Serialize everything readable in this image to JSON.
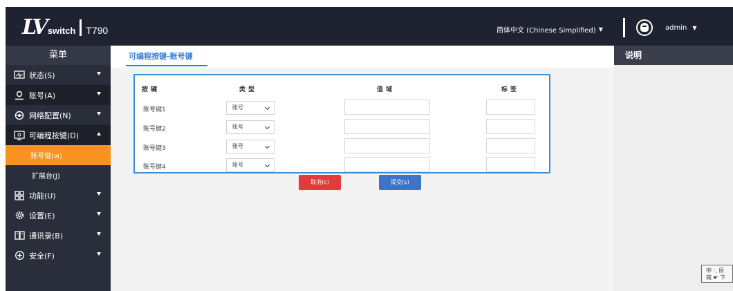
{
  "header": {
    "logo_mark": "LV",
    "logo_text": "switch",
    "model": "T790",
    "language": "简体中文 (Chinese Simplified)",
    "user": "admin"
  },
  "sidebar": {
    "title": "菜单",
    "items": [
      {
        "label": "状态(S)",
        "icon": "monitor-icon",
        "arrow": "down"
      },
      {
        "label": "账号(A)",
        "icon": "user-icon",
        "arrow": "down"
      },
      {
        "label": "网络配置(N)",
        "icon": "network-icon",
        "arrow": "down"
      },
      {
        "label": "可编程按键(D)",
        "icon": "keyboard-icon",
        "arrow": "up"
      }
    ],
    "subitems": [
      {
        "label": "账号键(w)",
        "active": true
      },
      {
        "label": "扩展台(J)",
        "active": false
      }
    ],
    "items2": [
      {
        "label": "功能(U)",
        "icon": "grid-icon",
        "arrow": "down"
      },
      {
        "label": "设置(E)",
        "icon": "gear-icon",
        "arrow": "down"
      },
      {
        "label": "通讯录(B)",
        "icon": "book-icon",
        "arrow": "down"
      },
      {
        "label": "安全(F)",
        "icon": "shield-icon",
        "arrow": "down"
      }
    ]
  },
  "main": {
    "breadcrumb": "可编程按键-账号键",
    "table": {
      "headers": [
        "按键",
        "类型",
        "值域",
        "标签"
      ],
      "rows": [
        {
          "key": "账号键1",
          "type": "账号",
          "value": "",
          "label": ""
        },
        {
          "key": "账号键2",
          "type": "账号",
          "value": "",
          "label": ""
        },
        {
          "key": "账号键3",
          "type": "账号",
          "value": "",
          "label": ""
        },
        {
          "key": "账号键4",
          "type": "账号",
          "value": "",
          "label": ""
        }
      ]
    },
    "cancel_label": "取消(c)",
    "submit_label": "提交(s)"
  },
  "help": {
    "title": "说明",
    "ime_line1": "中 ·, 目",
    "ime_line2": "简 ☛ 下"
  },
  "colors": {
    "header_bg": "#1f2230",
    "sidebar_bg": "#2a2d3a",
    "active_orange": "#f7931e",
    "accent_blue": "#3a7fd5",
    "cancel_red": "#e23b3b",
    "submit_blue": "#3d73c9"
  }
}
